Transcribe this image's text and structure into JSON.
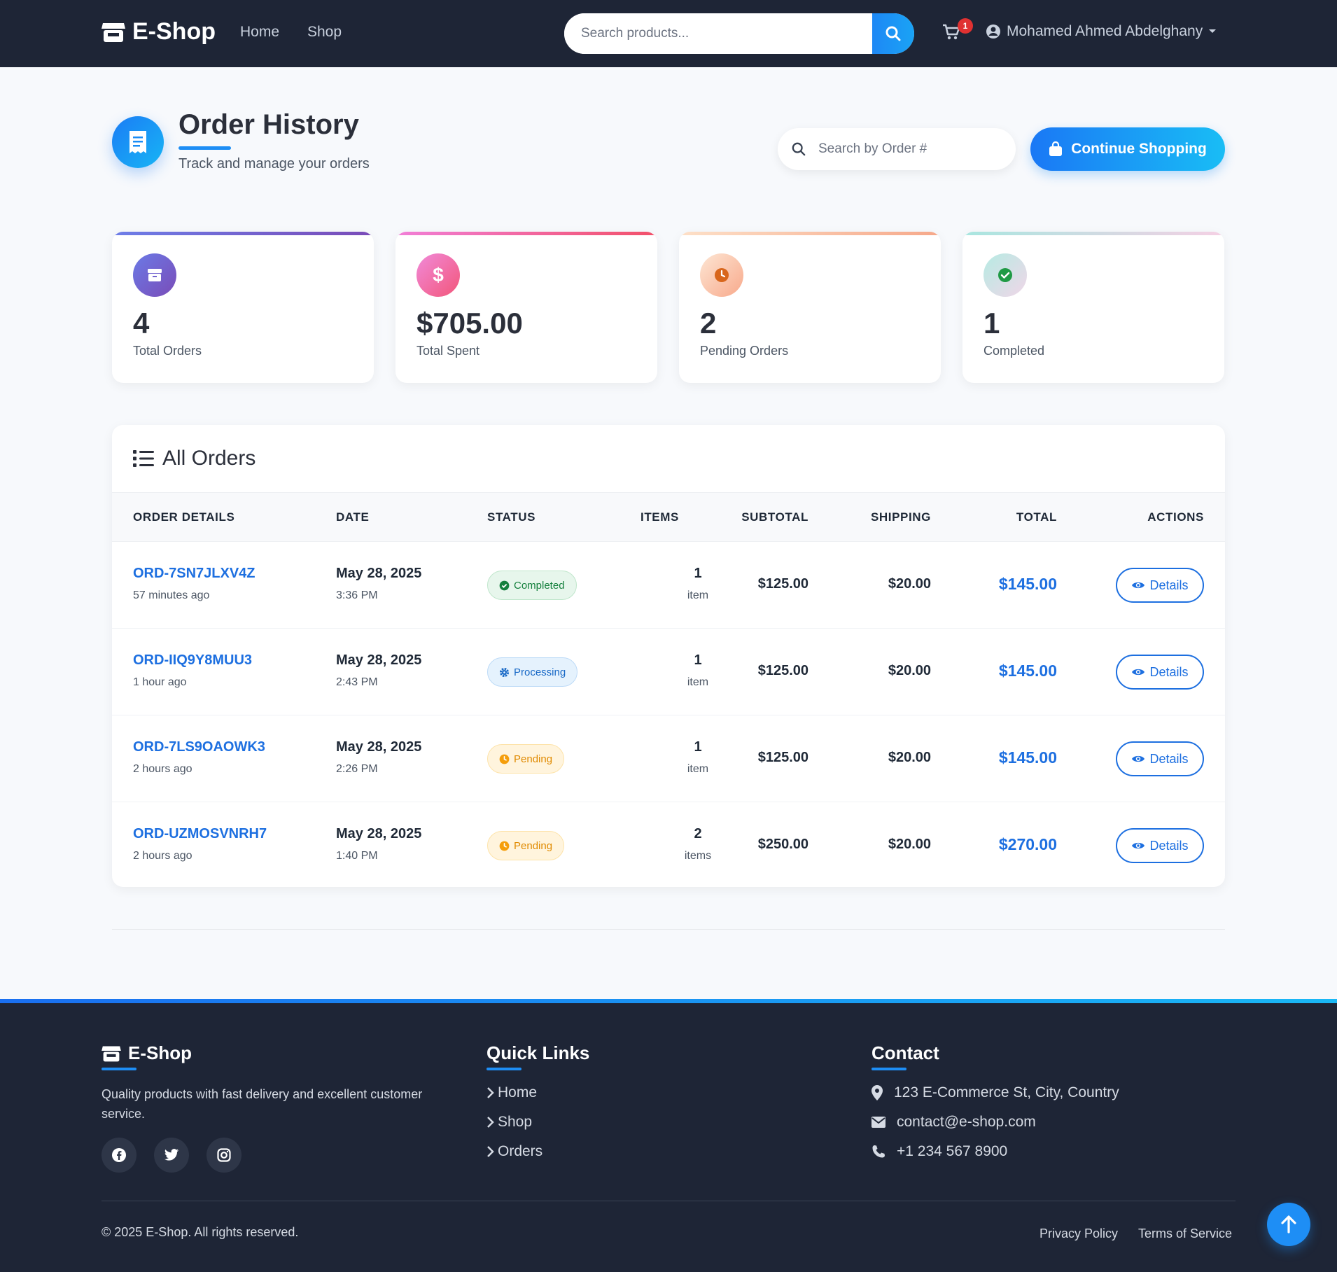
{
  "nav": {
    "brand": "E-Shop",
    "links": [
      "Home",
      "Shop"
    ],
    "search_placeholder": "Search products...",
    "cart_count": "1",
    "user_name": "Mohamed Ahmed Abdelghany"
  },
  "header": {
    "title": "Order History",
    "subtitle": "Track and manage your orders",
    "search_placeholder": "Search by Order #",
    "continue_label": "Continue Shopping"
  },
  "stats": [
    {
      "value": "4",
      "label": "Total Orders",
      "icon": "box-icon",
      "color": "#6a5ad6"
    },
    {
      "value": "$705.00",
      "label": "Total Spent",
      "icon": "dollar-icon",
      "color": "#ef4f8a"
    },
    {
      "value": "2",
      "label": "Pending Orders",
      "icon": "clock-icon",
      "color": "#e0701f"
    },
    {
      "value": "1",
      "label": "Completed",
      "icon": "check-circle-icon",
      "color": "#22a04b"
    }
  ],
  "orders": {
    "title": "All Orders",
    "columns": [
      "ORDER DETAILS",
      "DATE",
      "STATUS",
      "ITEMS",
      "SUBTOTAL",
      "SHIPPING",
      "TOTAL",
      "ACTIONS"
    ],
    "rows": [
      {
        "id": "ORD-7SN7JLXV4Z",
        "ago": "57 minutes ago",
        "date": "May 28, 2025",
        "time": "3:36 PM",
        "status": "Completed",
        "items": "1",
        "items_unit": "item",
        "subtotal": "$125.00",
        "shipping": "$20.00",
        "total": "$145.00",
        "action": "Details"
      },
      {
        "id": "ORD-IIQ9Y8MUU3",
        "ago": "1 hour ago",
        "date": "May 28, 2025",
        "time": "2:43 PM",
        "status": "Processing",
        "items": "1",
        "items_unit": "item",
        "subtotal": "$125.00",
        "shipping": "$20.00",
        "total": "$145.00",
        "action": "Details"
      },
      {
        "id": "ORD-7LS9OAOWK3",
        "ago": "2 hours ago",
        "date": "May 28, 2025",
        "time": "2:26 PM",
        "status": "Pending",
        "items": "1",
        "items_unit": "item",
        "subtotal": "$125.00",
        "shipping": "$20.00",
        "total": "$145.00",
        "action": "Details"
      },
      {
        "id": "ORD-UZMOSVNRH7",
        "ago": "2 hours ago",
        "date": "May 28, 2025",
        "time": "1:40 PM",
        "status": "Pending",
        "items": "2",
        "items_unit": "items",
        "subtotal": "$250.00",
        "shipping": "$20.00",
        "total": "$270.00",
        "action": "Details"
      }
    ]
  },
  "footer": {
    "brand": "E-Shop",
    "description": "Quality products with fast delivery and excellent customer service.",
    "quick_links_title": "Quick Links",
    "quick_links": [
      "Home",
      "Shop",
      "Orders"
    ],
    "contact_title": "Contact",
    "address": "123 E-Commerce St, City, Country",
    "email": "contact@e-shop.com",
    "phone": "+1 234 567 8900",
    "copyright": "© 2025 E-Shop. All rights reserved.",
    "privacy": "Privacy Policy",
    "terms": "Terms of Service"
  },
  "colors": {
    "accent": "#1d6fe0",
    "navbar": "#1e2536"
  }
}
